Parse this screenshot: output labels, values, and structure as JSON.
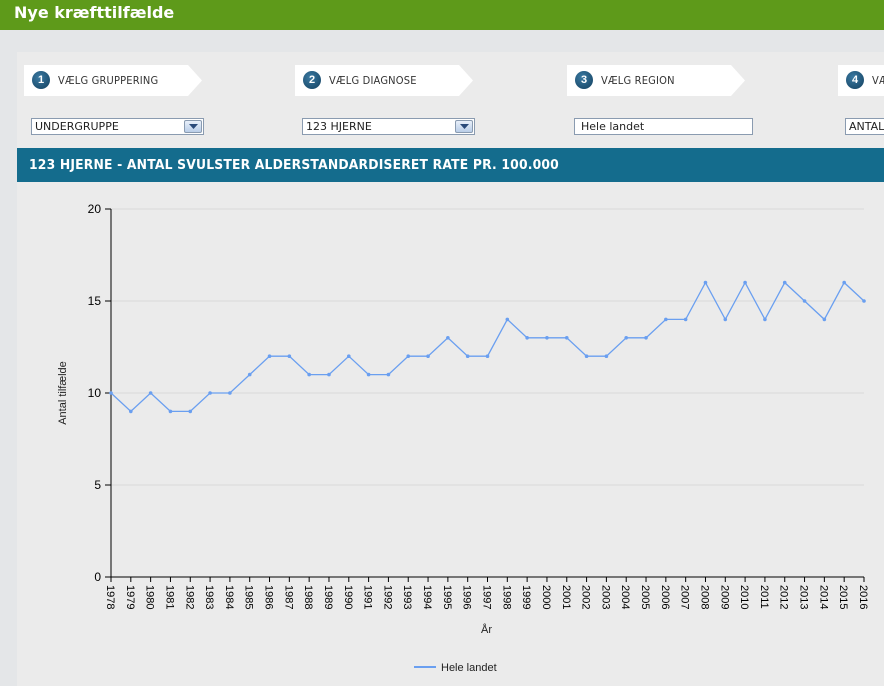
{
  "app": {
    "title": "Nye kræfttilfælde"
  },
  "steps": [
    {
      "num": "1",
      "label": "VÆLG GRUPPERING",
      "value": "UNDERGRUPPE"
    },
    {
      "num": "2",
      "label": "VÆLG DIAGNOSE",
      "value": "123 HJERNE"
    },
    {
      "num": "3",
      "label": "VÆLG REGION",
      "value": "Hele landet"
    },
    {
      "num": "4",
      "label": "VÆ",
      "value": "ANTAL"
    }
  ],
  "chart_header": "123 HJERNE - ANTAL SVULSTER ALDERSTANDARDISERET RATE PR. 100.000",
  "chart_data": {
    "type": "line",
    "xlabel": "År",
    "ylabel": "Antal tilfælde",
    "ylim": [
      0,
      20
    ],
    "yticks": [
      0,
      5,
      10,
      15,
      20
    ],
    "grid": true,
    "legend_position": "bottom",
    "series_color": "#6a9ff0",
    "x": [
      "1978",
      "1979",
      "1980",
      "1981",
      "1982",
      "1983",
      "1984",
      "1985",
      "1986",
      "1987",
      "1988",
      "1989",
      "1990",
      "1991",
      "1992",
      "1993",
      "1994",
      "1995",
      "1996",
      "1997",
      "1998",
      "1999",
      "2000",
      "2001",
      "2002",
      "2003",
      "2004",
      "2005",
      "2006",
      "2007",
      "2008",
      "2009",
      "2010",
      "2011",
      "2012",
      "2013",
      "2014",
      "2015",
      "2016"
    ],
    "series": [
      {
        "name": "Hele landet",
        "values": [
          10,
          9,
          10,
          9,
          9,
          10,
          10,
          11,
          12,
          12,
          11,
          11,
          12,
          11,
          11,
          12,
          12,
          13,
          12,
          12,
          14,
          13,
          13,
          13,
          12,
          12,
          13,
          13,
          14,
          14,
          16,
          14,
          16,
          14,
          16,
          15,
          14,
          16,
          15
        ]
      }
    ]
  }
}
